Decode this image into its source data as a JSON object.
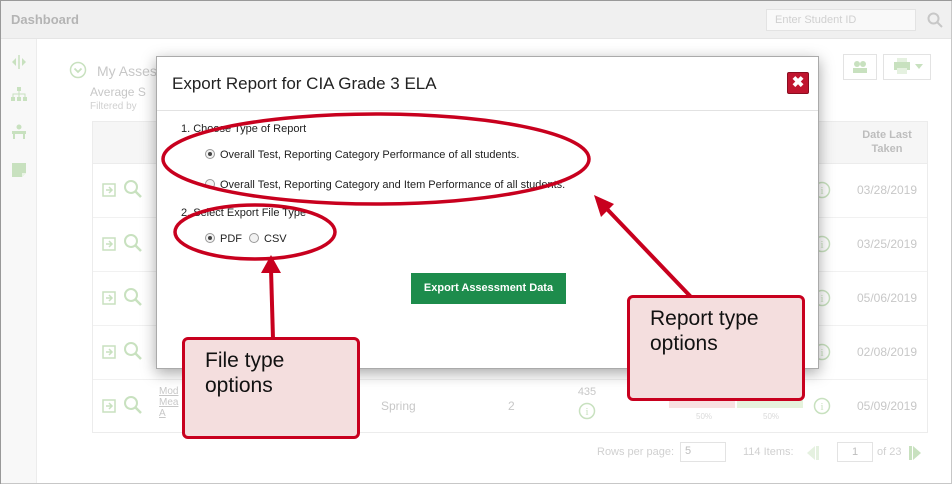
{
  "topbar": {
    "title": "Dashboard",
    "search_placeholder": "Enter Student ID"
  },
  "background": {
    "title": "My Asses",
    "subtitle": "Average S",
    "filter": "Filtered by",
    "date_header": "Date Last Taken",
    "rows": [
      {
        "date": "03/28/2019"
      },
      {
        "date": "03/25/2019"
      },
      {
        "date": "05/06/2019"
      },
      {
        "date": "02/08/2019"
      },
      {
        "date": "05/09/2019",
        "name": "Mod Mea A",
        "season": "Spring",
        "num": "2",
        "score": "435",
        "pct_low": "50%",
        "pct_high": "50%"
      }
    ],
    "pager": {
      "rows_label": "Rows per page:",
      "rows_value": "5",
      "items": "114 Items:",
      "page": "1",
      "of": "of 23"
    }
  },
  "modal": {
    "title": "Export Report for CIA Grade 3 ELA",
    "close_label": "✖",
    "step1": "1.   Choose Type of Report",
    "report_options": [
      {
        "label": "Overall Test, Reporting Category Performance of all students.",
        "selected": true
      },
      {
        "label": "Overall Test, Reporting Category and Item Performance of all students.",
        "selected": false
      }
    ],
    "step2": "2.   Select Export File Type",
    "file_options": [
      {
        "label": "PDF",
        "selected": true
      },
      {
        "label": "CSV",
        "selected": false
      }
    ],
    "export_button": "Export Assessment Data"
  },
  "annotations": {
    "callout_file": "File type options",
    "callout_report": "Report type options",
    "color": "#c8001e"
  }
}
